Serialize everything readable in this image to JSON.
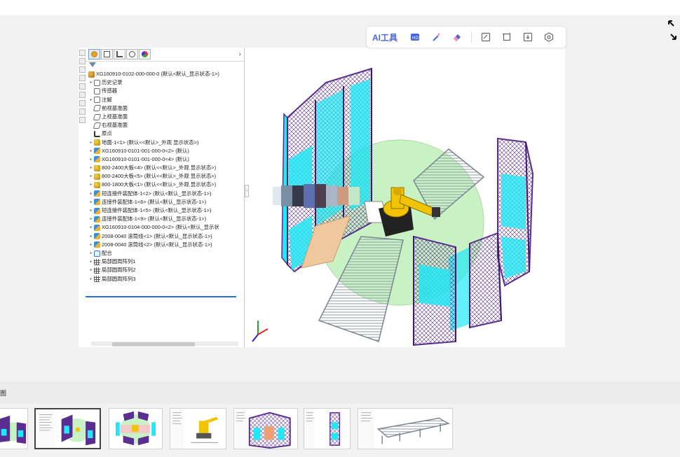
{
  "toolbar": {
    "ai_label": "AI工具",
    "icons": [
      "hd-image-icon",
      "magic-wand-icon",
      "eraser-icon",
      "edit-image-icon",
      "crop-icon",
      "download-icon",
      "settings-icon"
    ]
  },
  "tree": {
    "root": "XG160910-0102-000-000-0 (默认<默认_显示状态-1>)",
    "items": [
      {
        "label": "历史记录",
        "icon": "history-icon",
        "arrow": true
      },
      {
        "label": "传感器",
        "icon": "sensor-icon",
        "arrow": false
      },
      {
        "label": "注解",
        "icon": "annotation-icon",
        "arrow": true
      },
      {
        "label": "前视基准面",
        "icon": "plane-icon",
        "arrow": false
      },
      {
        "label": "上视基准面",
        "icon": "plane-icon",
        "arrow": false
      },
      {
        "label": "右视基准面",
        "icon": "plane-icon",
        "arrow": false
      },
      {
        "label": "原点",
        "icon": "origin-icon",
        "arrow": false
      },
      {
        "label": "地面-1<1> (默认<<默认>_外观 显示状态>)",
        "icon": "part-icon",
        "arrow": true
      },
      {
        "label": "XG160910-0101-001-000-0<2> (默认)",
        "icon": "assembly-icon",
        "arrow": true
      },
      {
        "label": "XG160910-0101-001-000-0<4> (默认)",
        "icon": "assembly-icon",
        "arrow": true
      },
      {
        "label": "800-2400大板<4> (默认<<默认>_外观 显示状态>)",
        "icon": "part-icon",
        "arrow": true
      },
      {
        "label": "800-2400大板<5> (默认<<默认>_外观 显示状态>)",
        "icon": "part-icon",
        "arrow": true
      },
      {
        "label": "800-1800大板<1> (默认<<默认>_外观 显示状态>)",
        "icon": "part-icon",
        "arrow": true
      },
      {
        "label": "短连接件装配体-1<2> (默认<默认_显示状态-1>)",
        "icon": "assembly-icon",
        "arrow": true
      },
      {
        "label": "连接件装配体-1<6> (默认<默认_显示状态-1>)",
        "icon": "assembly-icon",
        "arrow": true
      },
      {
        "label": "短连接件装配体-1<5> (默认<默认_显示状态-1>)",
        "icon": "assembly-icon",
        "arrow": true
      },
      {
        "label": "连接件装配体-1<9> (默认<默认_显示状态-1>)",
        "icon": "assembly-icon",
        "arrow": true
      },
      {
        "label": "XG160910-0104-000-000-0<2> (默认<默认_显示状",
        "icon": "assembly-warning-icon",
        "arrow": true
      },
      {
        "label": "2008-0040 滚筒线<1> (默认<默认_显示状态-1>)",
        "icon": "assembly-icon",
        "arrow": true
      },
      {
        "label": "2008-0040 滚筒线<2> (默认<默认_显示状态-1>)",
        "icon": "assembly-icon",
        "arrow": true
      },
      {
        "label": "配合",
        "icon": "mate-icon",
        "arrow": true
      },
      {
        "label": "局部圆周阵列1",
        "icon": "pattern-icon",
        "arrow": true
      },
      {
        "label": "局部圆周阵列2",
        "icon": "pattern-icon",
        "arrow": true
      },
      {
        "label": "局部圆周阵列3",
        "icon": "pattern-icon",
        "arrow": true
      }
    ]
  },
  "strip": {
    "label": "图",
    "thumbs": [
      "thumb-1",
      "thumb-2",
      "thumb-3",
      "thumb-4",
      "thumb-5",
      "thumb-6",
      "thumb-7"
    ],
    "selected_index": 1
  },
  "colors": {
    "frame_purple": "#5a2d91",
    "panel_cyan": "#22e8f5",
    "floor_green": "#c9f2c4",
    "robot_yellow": "#f2c300",
    "accent_blue": "#4a63e0"
  }
}
